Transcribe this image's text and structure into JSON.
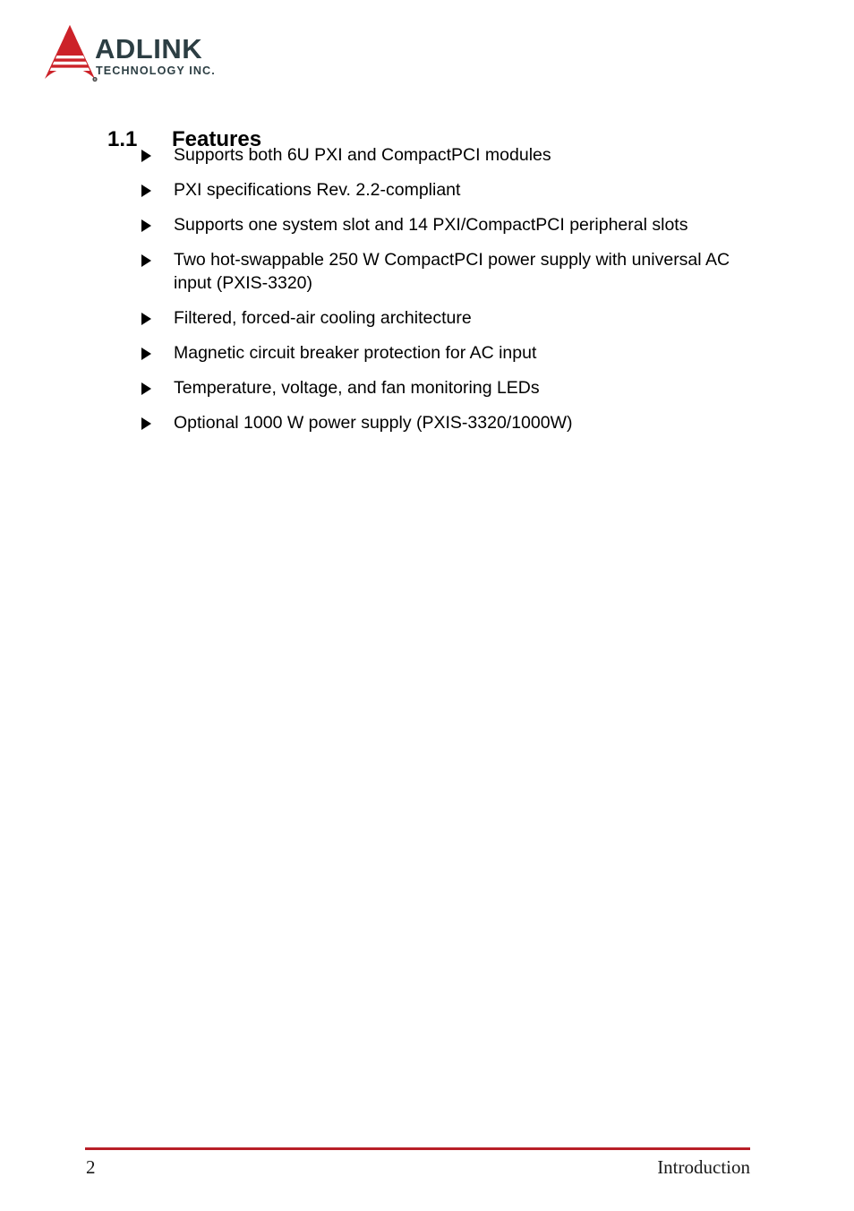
{
  "document": {
    "page_number": "2",
    "footer_section": "Introduction"
  },
  "header": {
    "logo": {
      "mark_name": "adlink-triangle-logo",
      "mark_color": "#cc2229",
      "registered_symbol": "®",
      "company_name": "ADLINK",
      "tagline": "TECHNOLOGY INC.",
      "text_color": "#2c3e43"
    }
  },
  "section": {
    "number": "1.1",
    "title": "Features"
  },
  "features": {
    "bullet_icon": "triangle-right-icon",
    "items": [
      {
        "text": "Supports both 6U PXI and CompactPCI modules"
      },
      {
        "text": "PXI specifications Rev. 2.2-compliant"
      },
      {
        "text": "Supports one system slot and 14 PXI/CompactPCI peripheral slots"
      },
      {
        "text": "Two hot-swappable 250 W CompactPCI power supply with universal AC input (PXIS-3320)"
      },
      {
        "text": "Filtered, forced-air cooling architecture"
      },
      {
        "text": "Magnetic circuit breaker protection for AC input"
      },
      {
        "text": "Temperature, voltage, and fan monitoring LEDs"
      },
      {
        "text": "Optional 1000 W power supply (PXIS-3320/1000W)"
      }
    ]
  },
  "colors": {
    "footer_rule": "#b81f28",
    "logo_red": "#cc2229",
    "logo_slate": "#2c3e43",
    "body_text": "#000000"
  }
}
